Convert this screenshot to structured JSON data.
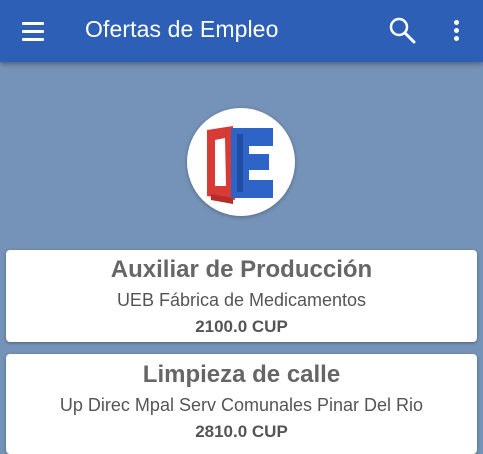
{
  "appbar": {
    "title": "Ofertas de Empleo",
    "menu_icon": "hamburger-menu-icon",
    "search_icon": "search-icon",
    "more_icon": "more-vertical-icon",
    "background_color": "#2e5fb7"
  },
  "logo": {
    "text": "OE",
    "colors": {
      "red": "#d83a35",
      "blue": "#2e64c8"
    }
  },
  "page": {
    "background_color": "#7593b9"
  },
  "jobs": [
    {
      "title": "Auxiliar de Producción",
      "company": "UEB Fábrica de Medicamentos",
      "salary": "2100.0 CUP"
    },
    {
      "title": "Limpieza de calle",
      "company": "Up Direc Mpal Serv Comunales Pinar Del Rio",
      "salary": "2810.0 CUP"
    }
  ]
}
